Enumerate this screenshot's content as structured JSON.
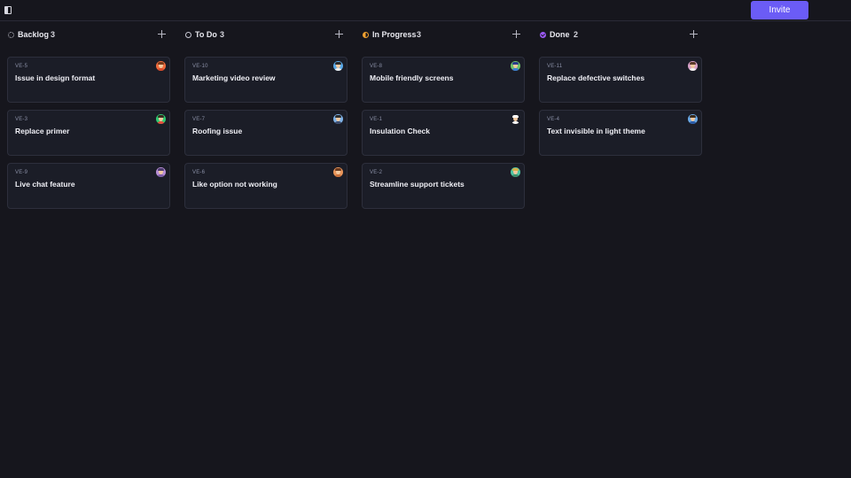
{
  "header": {
    "invite_label": "Invite"
  },
  "columns": [
    {
      "title": "Backlog",
      "count": "3",
      "status_icon": "backlog-icon",
      "cards": [
        {
          "id": "VE-5",
          "title": "Issue in design format",
          "avatar_bg": "#f06b3c",
          "hair": "#7a3a1a",
          "body": "#d94a2a"
        },
        {
          "id": "VE-3",
          "title": "Replace primer",
          "avatar_bg": "#2ecc71",
          "hair": "#3b2a20",
          "body": "#e74c3c"
        },
        {
          "id": "VE-9",
          "title": "Live chat feature",
          "avatar_bg": "#b88fd6",
          "hair": "#4b3b6b",
          "body": "#7b5ca6"
        }
      ]
    },
    {
      "title": "To Do",
      "count": "3",
      "status_icon": "todo-icon",
      "cards": [
        {
          "id": "VE-10",
          "title": "Marketing video review",
          "avatar_bg": "#5aa8e6",
          "hair": "#2b2b2b",
          "body": "#f0f0f0"
        },
        {
          "id": "VE-7",
          "title": "Roofing issue",
          "avatar_bg": "#7fb3e8",
          "hair": "#2d2d2d",
          "body": "#3b4a6b"
        },
        {
          "id": "VE-6",
          "title": "Like option not working",
          "avatar_bg": "#e8955a",
          "hair": "#6b3a1e",
          "body": "#c9703a"
        }
      ]
    },
    {
      "title": "In Progress",
      "count": "3",
      "status_icon": "in-progress-icon",
      "cards": [
        {
          "id": "VE-8",
          "title": "Mobile friendly screens",
          "avatar_bg": "#6fc36b",
          "hair": "#2b3b8b",
          "body": "#3b7bd6"
        },
        {
          "id": "VE-1",
          "title": "Insulation Check",
          "avatar_bg": "#1b1d27",
          "hair": "#ffffff",
          "body": "#ffffff"
        },
        {
          "id": "VE-2",
          "title": "Streamline support tickets",
          "avatar_bg": "#4fc3a1",
          "hair": "#d6b24a",
          "body": "#3b8b6b"
        }
      ]
    },
    {
      "title": "Done",
      "count": "2",
      "status_icon": "done-icon",
      "cards": [
        {
          "id": "VE-11",
          "title": "Replace defective switches",
          "avatar_bg": "#d9a3c9",
          "hair": "#5b3a2a",
          "body": "#f0f0f0"
        },
        {
          "id": "VE-4",
          "title": "Text invisible in light theme",
          "avatar_bg": "#6aa9e6",
          "hair": "#3b2a1a",
          "body": "#2b5ba6"
        }
      ]
    }
  ]
}
